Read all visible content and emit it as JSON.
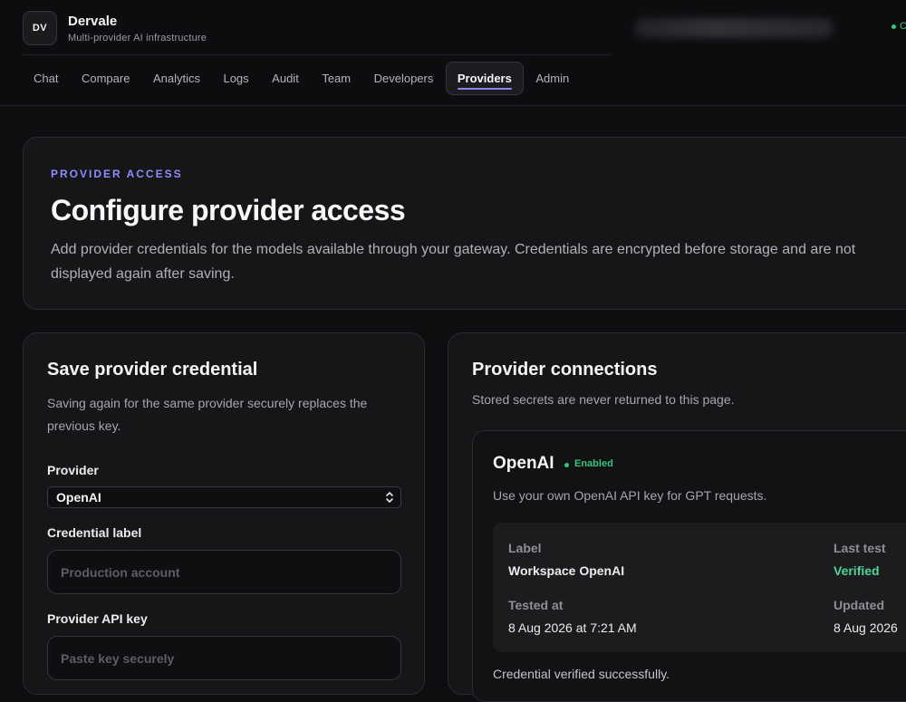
{
  "brand": {
    "logo_text": "DV",
    "name": "Dervale",
    "subtitle": "Multi-provider AI infrastructure"
  },
  "header": {
    "status_letter": "C",
    "status_color": "#34c77b"
  },
  "nav": {
    "items": [
      {
        "label": "Chat"
      },
      {
        "label": "Compare"
      },
      {
        "label": "Analytics"
      },
      {
        "label": "Logs"
      },
      {
        "label": "Audit"
      },
      {
        "label": "Team"
      },
      {
        "label": "Developers"
      },
      {
        "label": "Providers",
        "active": true
      },
      {
        "label": "Admin"
      }
    ],
    "accent_color": "#8a86f0"
  },
  "hero": {
    "eyebrow": "PROVIDER ACCESS",
    "title": "Configure provider access",
    "description": "Add provider credentials for the models available through your gateway. Credentials are encrypted before storage and are not displayed again after saving."
  },
  "save_form": {
    "title": "Save provider credential",
    "subtitle": "Saving again for the same provider securely replaces the previous key.",
    "provider_label": "Provider",
    "provider_value": "OpenAI",
    "credential_label": "Credential label",
    "credential_placeholder": "Production account",
    "api_key_label": "Provider API key",
    "api_key_placeholder": "Paste key securely"
  },
  "connections": {
    "title": "Provider connections",
    "subtitle": "Stored secrets are never returned to this page.",
    "items": [
      {
        "name": "OpenAI",
        "status": "Enabled",
        "status_color": "#35c27d",
        "description": "Use your own OpenAI API key for GPT requests.",
        "label_heading": "Label",
        "label_value": "Workspace OpenAI",
        "last_test_heading": "Last test",
        "last_test_value": "Verified",
        "tested_at_heading": "Tested at",
        "tested_at_value": "8 Aug 2026 at 7:21 AM",
        "updated_heading": "Updated",
        "updated_value": "8 Aug 2026",
        "footer": "Credential verified successfully."
      }
    ]
  }
}
